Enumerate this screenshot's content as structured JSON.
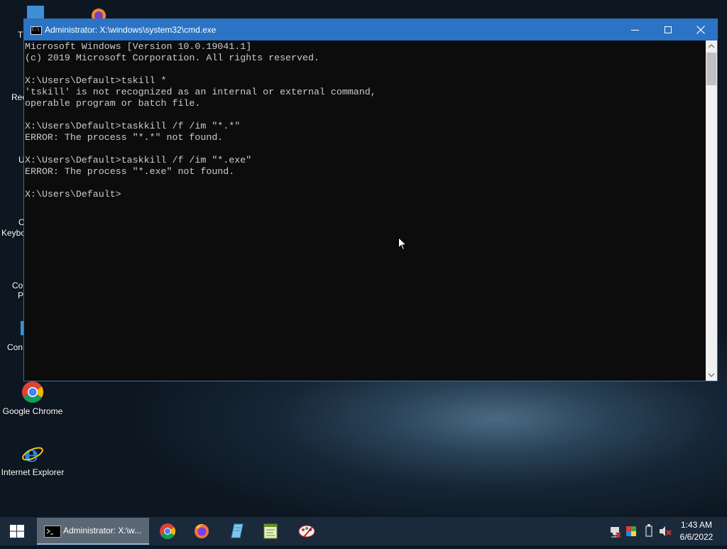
{
  "desktop": {
    "icons": [
      {
        "label": "Google Chrome",
        "icon": "chrome-icon"
      },
      {
        "label": "Internet Explorer",
        "icon": "internet-explorer-icon"
      }
    ],
    "partial_labels": [
      "T",
      "Rec",
      "UX",
      "C",
      "Keybo",
      "Co",
      "P",
      "Con"
    ]
  },
  "window": {
    "title": "Administrator: X:\\windows\\system32\\cmd.exe",
    "icon_text": "C:\\",
    "buttons": {
      "minimize": "minimize-icon",
      "maximize": "maximize-icon",
      "close": "close-icon"
    },
    "console_lines": [
      "Microsoft Windows [Version 10.0.19041.1]",
      "(c) 2019 Microsoft Corporation. All rights reserved.",
      "",
      "X:\\Users\\Default>tskill *",
      "'tskill' is not recognized as an internal or external command,",
      "operable program or batch file.",
      "",
      "X:\\Users\\Default>taskkill /f /im \"*.*\"",
      "ERROR: The process \"*.*\" not found.",
      "",
      "X:\\Users\\Default>taskkill /f /im \"*.exe\"",
      "ERROR: The process \"*.exe\" not found.",
      "",
      "X:\\Users\\Default>"
    ]
  },
  "taskbar": {
    "start_icon": "windows-start-icon",
    "active_task_label": "Administrator: X:\\w...",
    "pinned": [
      "chrome-icon",
      "firefox-icon",
      "notepad-icon",
      "editor-icon",
      "paint-icon"
    ],
    "tray": [
      "network-icon",
      "color-icon",
      "usb-icon",
      "volume-muted-icon"
    ],
    "time": "1:43 AM",
    "date": "6/6/2022"
  },
  "colors": {
    "titlebar": "#2b73c5",
    "console_bg": "#0c0c0c",
    "console_fg": "#cccccc",
    "taskbar": "#1b2a3b"
  }
}
